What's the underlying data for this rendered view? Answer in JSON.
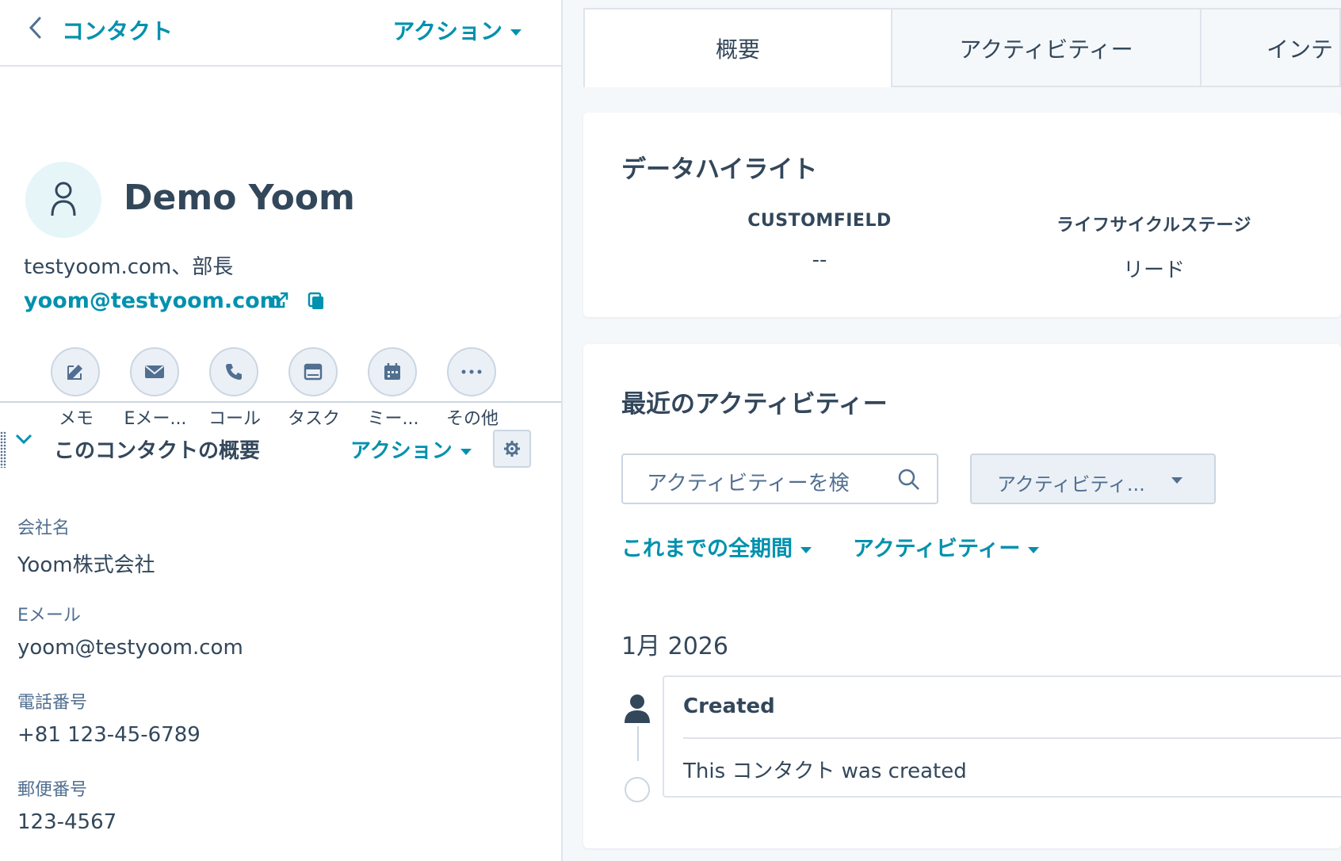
{
  "header": {
    "back_label": "コンタクト",
    "actions_label": "アクション"
  },
  "contact": {
    "name": "Demo Yoom",
    "subtitle": "testyoom.com、部長",
    "email": "yoom@testyoom.com"
  },
  "quick_actions": [
    "メモ",
    "Eメー...",
    "コール",
    "タスク",
    "ミー...",
    "その他"
  ],
  "summary": {
    "title": "このコンタクトの概要",
    "actions_label": "アクション",
    "properties": [
      {
        "label": "会社名",
        "value": "Yoom株式会社"
      },
      {
        "label": "Eメール",
        "value": "yoom@testyoom.com"
      },
      {
        "label": "電話番号",
        "value": "+81 123-45-6789"
      },
      {
        "label": "郵便番号",
        "value": "123-4567"
      }
    ]
  },
  "tabs": [
    "概要",
    "アクティビティー",
    "インテ"
  ],
  "highlights": {
    "title": "データハイライト",
    "items": [
      {
        "label": "CUSTOMFIELD",
        "value": "--"
      },
      {
        "label": "ライフサイクルステージ",
        "value": "リード"
      }
    ]
  },
  "activity": {
    "title": "最近のアクティビティー",
    "search_placeholder": "アクティビティーを検",
    "type_select": "アクティビティ...",
    "filters": [
      "これまでの全期間",
      "アクティビティー"
    ],
    "month": "1月 2026",
    "entry_title": "Created",
    "entry_body": "This コンタクト was created"
  },
  "colors": {
    "accent": "#0091ae",
    "text": "#33475b",
    "border": "#cbd6e2",
    "bg": "#f5f8fa"
  }
}
